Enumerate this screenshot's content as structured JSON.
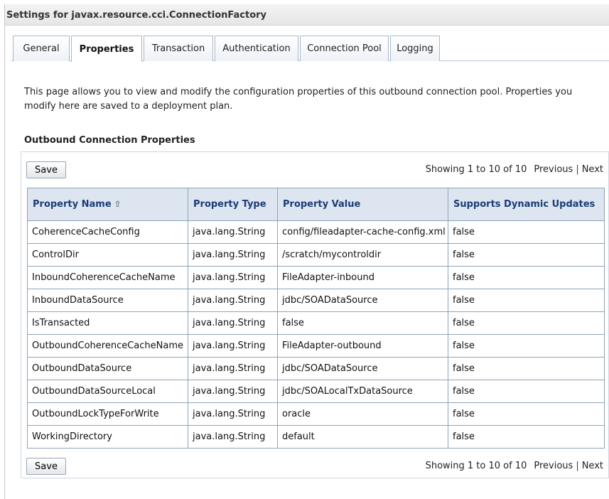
{
  "settings_title": "Settings for javax.resource.cci.ConnectionFactory",
  "tabs": [
    {
      "label": "General"
    },
    {
      "label": "Properties"
    },
    {
      "label": "Transaction"
    },
    {
      "label": "Authentication"
    },
    {
      "label": "Connection Pool"
    },
    {
      "label": "Logging"
    }
  ],
  "active_tab": "Properties",
  "description": "This page allows you to view and modify the configuration properties of this outbound connection pool. Properties you modify here are saved to a deployment plan.",
  "section_title": "Outbound Connection Properties",
  "toolbar": {
    "save_label": "Save",
    "showing_text": "Showing 1 to 10 of 10",
    "previous_label": "Previous",
    "separator": "|",
    "next_label": "Next"
  },
  "table": {
    "headers": [
      "Property Name",
      "Property Type",
      "Property Value",
      "Supports Dynamic Updates"
    ],
    "sort_icon": "sort-ascending-icon",
    "rows": [
      [
        "CoherenceCacheConfig",
        "java.lang.String",
        "config/fileadapter-cache-config.xml",
        "false"
      ],
      [
        "ControlDir",
        "java.lang.String",
        "/scratch/mycontroldir",
        "false"
      ],
      [
        "InboundCoherenceCacheName",
        "java.lang.String",
        "FileAdapter-inbound",
        "false"
      ],
      [
        "InboundDataSource",
        "java.lang.String",
        "jdbc/SOADataSource",
        "false"
      ],
      [
        "IsTransacted",
        "java.lang.String",
        "false",
        "false"
      ],
      [
        "OutboundCoherenceCacheName",
        "java.lang.String",
        "FileAdapter-outbound",
        "false"
      ],
      [
        "OutboundDataSource",
        "java.lang.String",
        "jdbc/SOADataSource",
        "false"
      ],
      [
        "OutboundDataSourceLocal",
        "java.lang.String",
        "jdbc/SOALocalTxDataSource",
        "false"
      ],
      [
        "OutboundLockTypeForWrite",
        "java.lang.String",
        "oracle",
        "false"
      ],
      [
        "WorkingDirectory",
        "java.lang.String",
        "default",
        "false"
      ]
    ]
  },
  "colors": {
    "header_bg": "#dde6f0",
    "header_text": "#1a3c78",
    "grid_border": "#8ea3b8"
  }
}
